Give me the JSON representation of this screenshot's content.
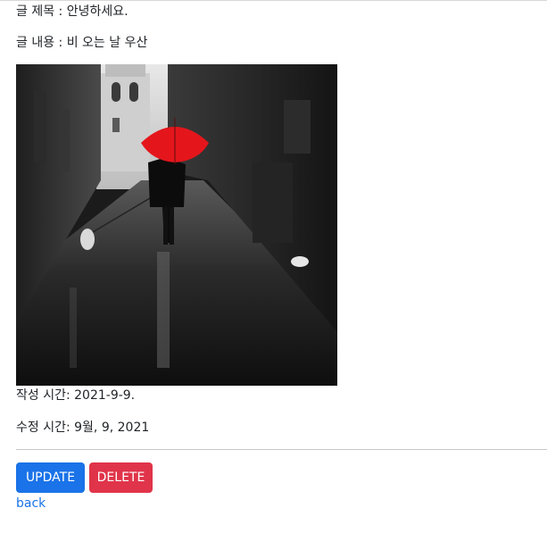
{
  "post": {
    "title_line": "글 제목 : 안녕하세요.",
    "content_line": "글 내용 : 비 오는 날 우산",
    "created_line": "작성 시간: 2021-9-9.",
    "updated_line": "수정 시간: 9월, 9, 2021"
  },
  "actions": {
    "update_label": "UPDATE",
    "delete_label": "DELETE",
    "back_label": "back"
  },
  "colors": {
    "update_button": "#1a73e8",
    "delete_button": "#e0344a",
    "link": "#1a73e8",
    "umbrella": "#e4161c"
  }
}
